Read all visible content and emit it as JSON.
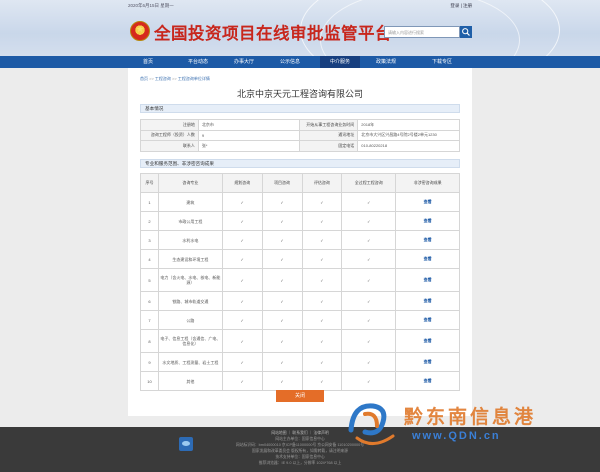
{
  "header": {
    "date": "2020年6月15日 星期一",
    "login_links": "登录 | 注册",
    "site_title": "全国投资项目在线审批监管平台",
    "search_placeholder": "请输入内容进行搜索"
  },
  "nav": [
    "首页",
    "平台动态",
    "办事大厅",
    "公示信息",
    "中介服务",
    "政策法规",
    "下载专区"
  ],
  "nav_active": "中介服务",
  "breadcrumb": [
    "首页",
    "工程咨询",
    "工程咨询单位详情"
  ],
  "company_name": "北京中京天元工程咨询有限公司",
  "basic": {
    "section_title": "基本情况",
    "rows": [
      {
        "l1": "注册地",
        "v1": "北京市",
        "l2": "开始从事工程咨询业务时间",
        "v2": "2018年"
      },
      {
        "l1": "咨询工程师（投资）人数",
        "v1": "9",
        "l2": "通讯地址",
        "v2": "北京市大兴区兴昌路4号院2号楼2单元1230"
      },
      {
        "l1": "联系人",
        "v1": "张*",
        "l2": "固定电话",
        "v2": "010-80220218"
      }
    ]
  },
  "majors": {
    "section_title": "专业和服务范围、非涉密咨询成果",
    "headers": [
      "序号",
      "咨询专业",
      "规划咨询",
      "项目咨询",
      "评估咨询",
      "全过程工程咨询",
      "非涉密咨询成果"
    ],
    "rows": [
      {
        "no": "1",
        "name": "建筑",
        "view": "查看"
      },
      {
        "no": "2",
        "name": "市政公用工程",
        "view": "查看"
      },
      {
        "no": "3",
        "name": "水利水电",
        "view": "查看"
      },
      {
        "no": "4",
        "name": "生态建设和环境工程",
        "view": "查看"
      },
      {
        "no": "5",
        "name": "电力（含火电、水电、核电、新能源）",
        "view": "查看"
      },
      {
        "no": "6",
        "name": "铁路、城市轨道交通",
        "view": "查看"
      },
      {
        "no": "7",
        "name": "公路",
        "view": "查看"
      },
      {
        "no": "8",
        "name": "电子、信息工程（含通信、广电、信息化）",
        "view": "查看"
      },
      {
        "no": "9",
        "name": "水文地质、工程测量、岩土工程",
        "view": "查看"
      },
      {
        "no": "10",
        "name": "其他",
        "view": "查看"
      }
    ],
    "check_mark": "✓"
  },
  "close_label": "关闭",
  "footer": {
    "links": "网站地图 ｜ 联系我们 ｜ 法律声明",
    "line2": "网站主办单位：国家信息中心",
    "line3": "网站标识码：bm04000010   京ICP备11000000号   京公网安备 11010200000号",
    "line4": "国家发展和改革委员会 版权所有，如需转载，请注明来源",
    "line5": "技术支持单位：国家信息中心",
    "line6": "推荐浏览器：IE 9.0 以上，分辨率 1024*768 以上"
  },
  "watermark": {
    "text": "黔东南信息港",
    "url": "www.QDN.cn"
  },
  "colors": {
    "nav": "#1d5aa6",
    "title": "#c8261c",
    "button": "#e46d28",
    "footer": "#3a3a3a"
  }
}
